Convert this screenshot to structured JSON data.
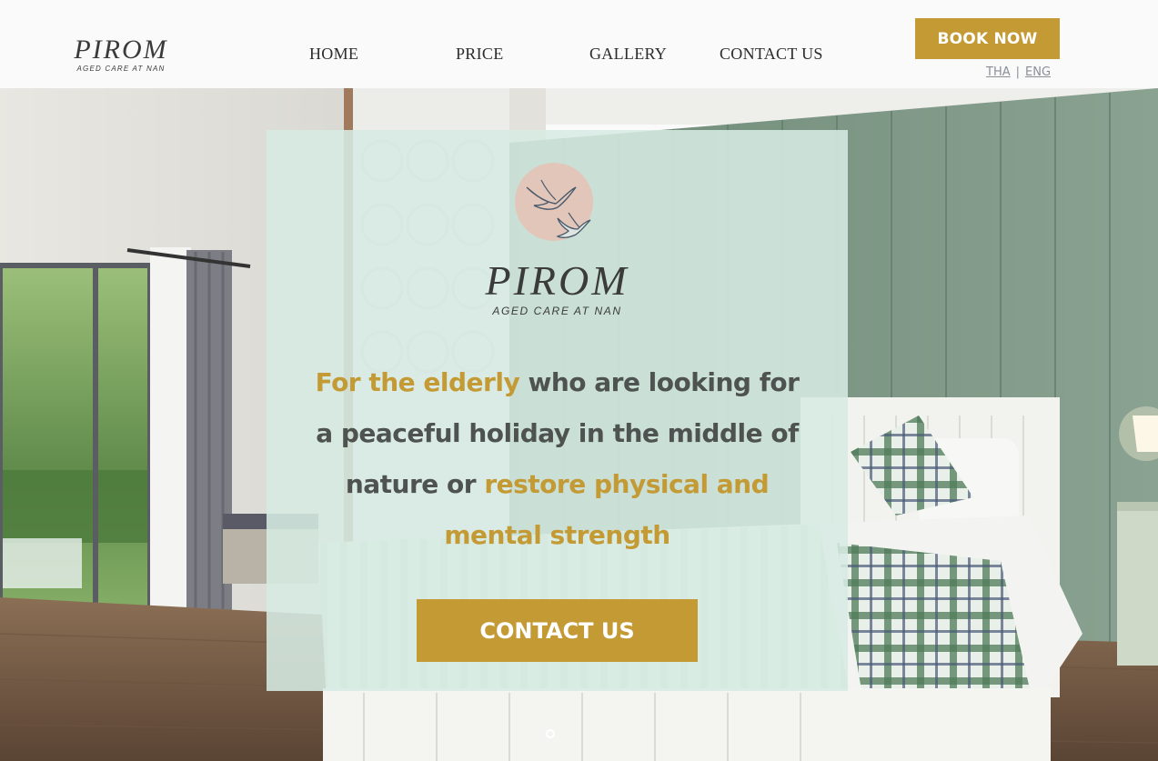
{
  "header": {
    "logo": {
      "name": "PIROM",
      "subtitle": "AGED CARE AT NAN"
    },
    "nav": [
      {
        "label": "HOME"
      },
      {
        "label": "PRICE"
      },
      {
        "label": "GALLERY"
      },
      {
        "label": "CONTACT US"
      }
    ],
    "book_label": "BOOK NOW",
    "languages": {
      "tha": "THA",
      "separator": "|",
      "eng": "ENG"
    }
  },
  "hero": {
    "logo": {
      "name": "PIROM",
      "subtitle": "AGED CARE AT NAN"
    },
    "tagline": {
      "highlight_1": "For the elderly",
      "text_1": " who are looking for a peaceful holiday in the middle of nature or ",
      "highlight_2": "restore physical and mental strength"
    },
    "cta_label": "CONTACT US",
    "emblem_icon": "swallows-icon"
  },
  "colors": {
    "accent": "#c39a34",
    "card_bg": "#d6eae2",
    "text_dark": "#4e5250",
    "wall_green": "#7d9786"
  }
}
